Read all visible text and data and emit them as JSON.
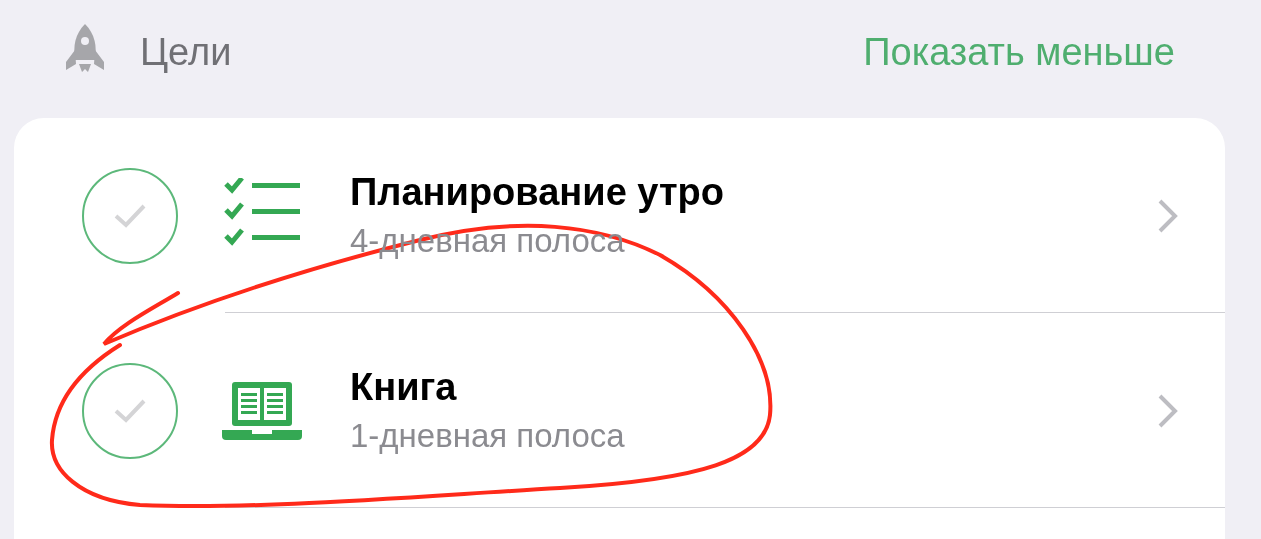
{
  "header": {
    "title": "Цели",
    "action": "Показать меньше"
  },
  "goals": [
    {
      "kind": "checklist",
      "title": "Планирование утро",
      "subtitle": "4-дневная полоса",
      "checked": false
    },
    {
      "kind": "book",
      "title": "Книга",
      "subtitle": "1-дневная полоса",
      "checked": false
    }
  ]
}
